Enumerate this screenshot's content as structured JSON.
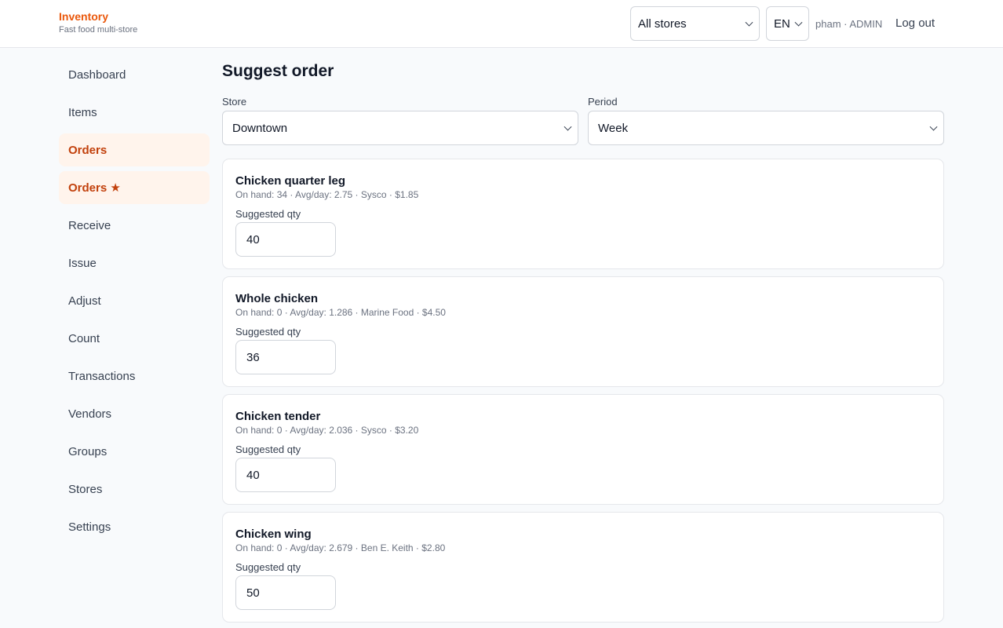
{
  "brand": {
    "title": "Inventory",
    "subtitle": "Fast food multi-store"
  },
  "header": {
    "store_select": "All stores",
    "lang_select": "EN",
    "user": "pham · ADMIN",
    "logout": "Log out"
  },
  "sidebar": {
    "items": [
      {
        "label": "Dashboard"
      },
      {
        "label": "Items"
      },
      {
        "label": "Orders",
        "active": true
      },
      {
        "label": "Orders ★",
        "active": true
      },
      {
        "label": "Receive"
      },
      {
        "label": "Issue"
      },
      {
        "label": "Adjust"
      },
      {
        "label": "Count"
      },
      {
        "label": "Transactions"
      },
      {
        "label": "Vendors"
      },
      {
        "label": "Groups"
      },
      {
        "label": "Stores"
      },
      {
        "label": "Settings"
      }
    ]
  },
  "main": {
    "title": "Suggest order",
    "store_label": "Store",
    "store_value": "Downtown",
    "period_label": "Period",
    "period_value": "Week",
    "qty_label": "Suggested qty",
    "items": [
      {
        "name": "Chicken quarter leg",
        "meta": "On hand: 34 · Avg/day: 2.75 · Sysco · $1.85",
        "qty": "40"
      },
      {
        "name": "Whole chicken",
        "meta": "On hand: 0 · Avg/day: 1.286 · Marine Food · $4.50",
        "qty": "36"
      },
      {
        "name": "Chicken tender",
        "meta": "On hand: 0 · Avg/day: 2.036 · Sysco · $3.20",
        "qty": "40"
      },
      {
        "name": "Chicken wing",
        "meta": "On hand: 0 · Avg/day: 2.679 · Ben E. Keith · $2.80",
        "qty": "50"
      }
    ]
  },
  "colors": {
    "brand": "#ea580c",
    "active_bg": "#fff4ec",
    "active_text": "#c2410c"
  }
}
